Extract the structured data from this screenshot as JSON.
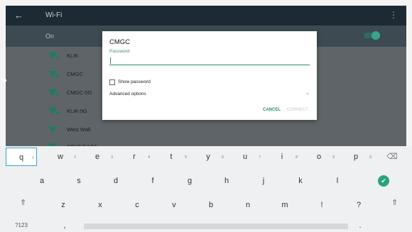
{
  "appbar": {
    "back_icon": "arrow-left-icon",
    "title": "Wi-Fi",
    "menu_icon": "overflow-menu-icon"
  },
  "onbar": {
    "label": "On"
  },
  "networks": [
    "KLIK",
    "CMGC",
    "CMGC-5G",
    "KLIK-5G",
    "West Wall",
    "ABUS E4 52"
  ],
  "side_chevron": "»",
  "dialog": {
    "title": "CMGC",
    "password_label": "Password",
    "password_value": "",
    "show_password": "Show password",
    "advanced_options": "Advanced options",
    "advanced_chevron": "⌄",
    "cancel": "CANCEL",
    "connect": "CONNECT"
  },
  "keyboard": {
    "row1": [
      {
        "k": "q",
        "h": "1"
      },
      {
        "k": "w",
        "h": "2"
      },
      {
        "k": "e",
        "h": "3"
      },
      {
        "k": "r",
        "h": "4"
      },
      {
        "k": "t",
        "h": "5"
      },
      {
        "k": "y",
        "h": "6"
      },
      {
        "k": "u",
        "h": "7"
      },
      {
        "k": "i",
        "h": "8"
      },
      {
        "k": "o",
        "h": "9"
      },
      {
        "k": "p",
        "h": "0"
      }
    ],
    "backspace": "⌫",
    "row2": [
      "a",
      "s",
      "d",
      "f",
      "g",
      "h",
      "j",
      "k",
      "l"
    ],
    "enter": "✔",
    "row3": [
      "z",
      "x",
      "c",
      "v",
      "b",
      "n",
      "m",
      "!",
      "?"
    ],
    "shift": "⇑",
    "symbols": "?123",
    "comma": ",",
    "period": "."
  },
  "colors": {
    "accent": "#2c8a77",
    "dark_bar": "#1e2a33",
    "enter": "#2aa37b"
  }
}
